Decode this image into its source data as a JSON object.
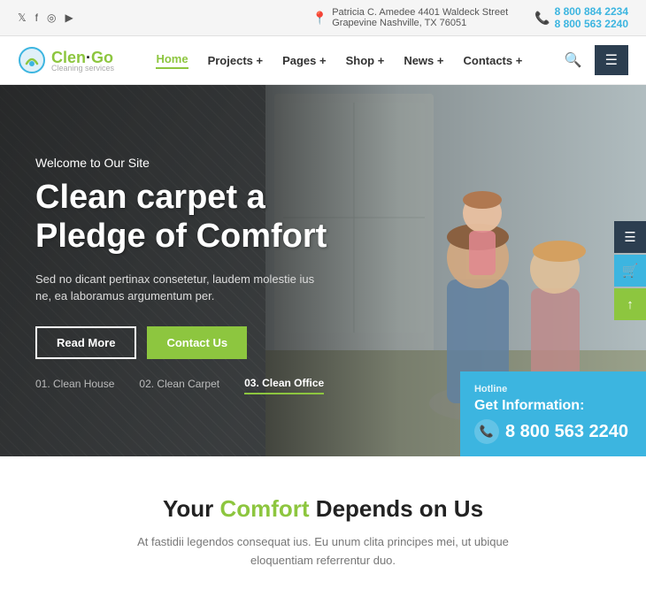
{
  "topbar": {
    "social": [
      "twitter",
      "facebook",
      "instagram",
      "youtube"
    ],
    "address_icon": "📍",
    "address_line1": "Patricia C. Amedee 4401 Waldeck Street",
    "address_line2": "Grapevine Nashville, TX 76051",
    "phone_icon": "📞",
    "phone1": "8 800 884 2234",
    "phone2": "8 800 563 2240"
  },
  "navbar": {
    "logo_name": "Clen",
    "logo_accent": "Go",
    "logo_sub": "Cleaning services",
    "links": [
      {
        "label": "Home",
        "active": true
      },
      {
        "label": "Projects +",
        "active": false
      },
      {
        "label": "Pages +",
        "active": false
      },
      {
        "label": "Shop +",
        "active": false
      },
      {
        "label": "News +",
        "active": false
      },
      {
        "label": "Contacts +",
        "active": false
      }
    ]
  },
  "hero": {
    "welcome": "Welcome to Our Site",
    "title_line1": "Clean carpet a",
    "title_line2": "Pledge of Comfort",
    "subtitle": "Sed no dicant pertinax consetetur, laudem molestie ius ne, ea laboramus argumentum per.",
    "btn_read": "Read More",
    "btn_contact": "Contact Us",
    "slides": [
      {
        "number": "01.",
        "label": "Clean House",
        "active": false
      },
      {
        "number": "02.",
        "label": "Clean Carpet",
        "active": false
      },
      {
        "number": "03.",
        "label": "Clean Office",
        "active": true
      }
    ],
    "hotline_label": "Hotline",
    "hotline_title": "Get Information:",
    "hotline_number": "8 800 563 2240"
  },
  "comfort": {
    "title_plain": "Your ",
    "title_highlight": "Comfort",
    "title_end": " Depends on Us",
    "subtitle": "At fastidii legendos consequat ius. Eu unum clita principes mei, ut ubique eloquentiam referrentur duo."
  },
  "floating": {
    "icons": [
      "☰",
      "🛒",
      "↑"
    ]
  }
}
